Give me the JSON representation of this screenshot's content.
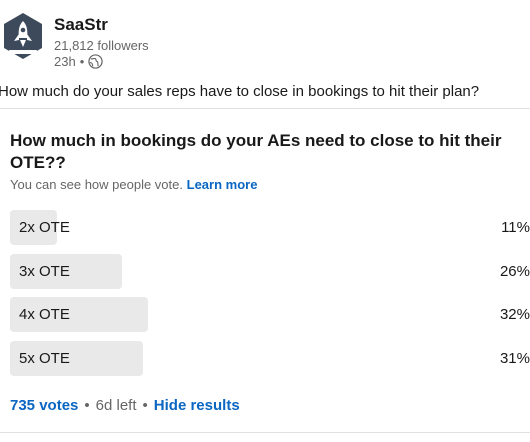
{
  "post": {
    "company": "SaaStr",
    "followers": "21,812 followers",
    "time": "23h",
    "separator": "•",
    "text": "How much do your sales reps have to close in bookings to hit their plan?"
  },
  "poll": {
    "question": "How much in bookings do your AEs need to close to hit their OTE??",
    "visibility_text": "You can see how people vote.",
    "learn_more": "Learn more",
    "options": [
      {
        "label": "2x OTE",
        "percent": "11%",
        "value": 11
      },
      {
        "label": "3x OTE",
        "percent": "26%",
        "value": 26
      },
      {
        "label": "4x OTE",
        "percent": "32%",
        "value": 32
      },
      {
        "label": "5x OTE",
        "percent": "31%",
        "value": 31
      }
    ],
    "votes": "735 votes",
    "sep": "•",
    "time_left": "6d left",
    "sep2": "•",
    "hide_results": "Hide results"
  },
  "icons": {
    "avatar": "saastr-rocket-logo",
    "visibility": "globe-icon"
  },
  "colors": {
    "link": "#0a66c2",
    "bar": "#e9e9e9",
    "logo_bg": "#3d4a5c"
  }
}
